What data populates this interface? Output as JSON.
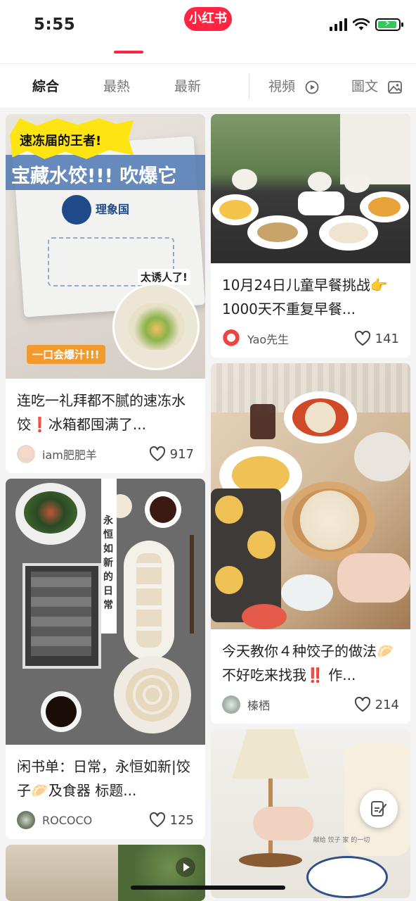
{
  "status_bar": {
    "time": "5:55"
  },
  "app": {
    "logo_text": "小红书",
    "brand_color": "#ff2442"
  },
  "tabs": [
    {
      "label": "綜合",
      "active": true
    },
    {
      "label": "最熱",
      "active": false
    },
    {
      "label": "最新",
      "active": false
    },
    {
      "label": "視頻",
      "icon": "play-circle-icon"
    },
    {
      "label": "圖文",
      "icon": "image-icon"
    }
  ],
  "cards": [
    {
      "title": "连吃一礼拜都不腻的速冻水饺❗冰箱都囤满了...",
      "author": "iam肥肥羊",
      "likes": "917",
      "image_texts": {
        "badge": "速冻届的王者!",
        "banner": "宝藏水饺!!! 吹爆它",
        "brand": "理象国",
        "tag1": "太诱人了!",
        "tag2": "一口会爆汁!!!"
      }
    },
    {
      "title": "10月24日儿童早餐挑战👉1000天不重复早餐...",
      "author": "Yao先生",
      "likes": "141"
    },
    {
      "title": "今天教你４种饺子的做法🥟不好吃来找我‼️ 作...",
      "author": "榛栖",
      "likes": "214"
    },
    {
      "title": "闲书单：日常，永恒如新|饺子🥟及食器 标题...",
      "author": "ROCOCO",
      "likes": "125",
      "image_texts": {
        "vertical": "永恒如新的日常"
      }
    },
    {
      "image_texts": {
        "caption": "献给 饺子 家 的一切"
      }
    }
  ]
}
